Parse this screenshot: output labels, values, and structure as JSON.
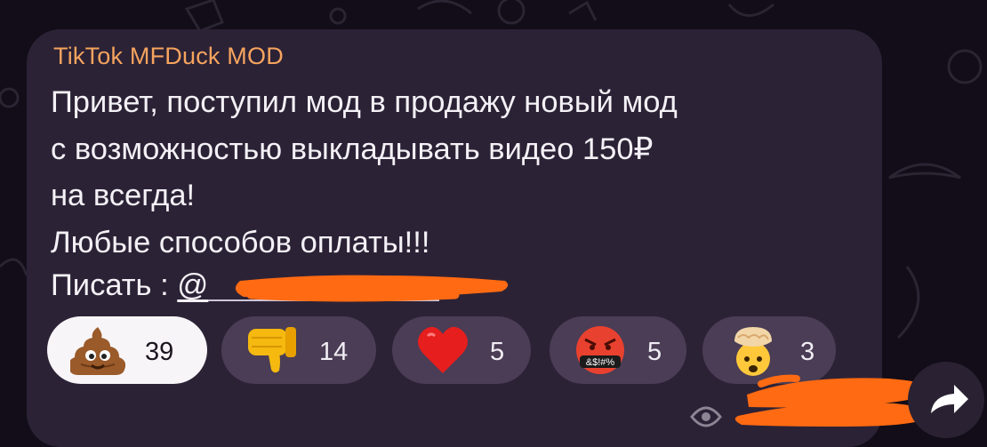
{
  "message": {
    "sender": "TikTok MFDuck MOD",
    "lines": [
      "Привет, поступил мод в продажу новый мод",
      "с возможностью выкладывать видео 150₽",
      "на всегда!",
      "Любые способов оплаты!!!"
    ],
    "contact_label": "Писать : ",
    "mention_prefix": "@"
  },
  "reactions": [
    {
      "emoji": "pile-of-poo",
      "count": "39",
      "selected": true
    },
    {
      "emoji": "thumbs-down",
      "count": "14",
      "selected": false
    },
    {
      "emoji": "red-heart",
      "count": "5",
      "selected": false
    },
    {
      "emoji": "face-with-symbols-on-mouth",
      "count": "5",
      "selected": false,
      "symbols": "&$!#%"
    },
    {
      "emoji": "exploding-head",
      "count": "3",
      "selected": false
    }
  ],
  "footer": {
    "views_icon": "eye-icon",
    "share_icon": "share-arrow-icon"
  },
  "colors": {
    "background": "#120d18",
    "bubble": "#2c2236",
    "sender": "#f6a45e",
    "text": "#f4f1f6",
    "reaction_bg": "#4a3d55",
    "reaction_selected_bg": "#f7f5f8",
    "redaction": "#ff6a12"
  }
}
